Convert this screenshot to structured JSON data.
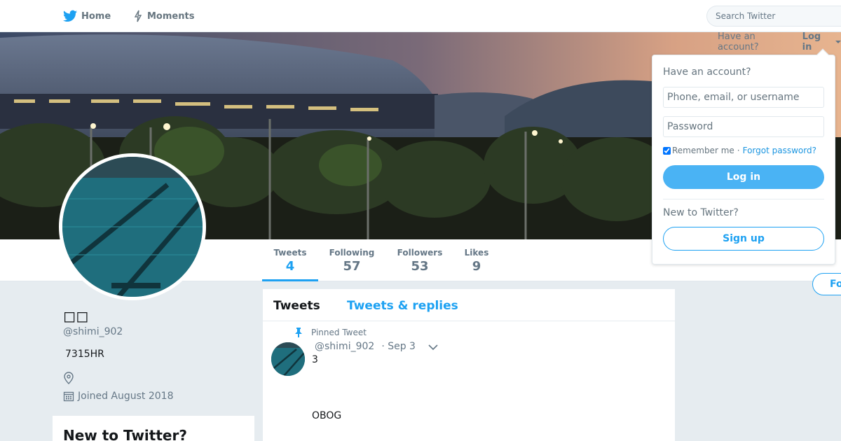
{
  "nav": {
    "home_label": "Home",
    "moments_label": "Moments",
    "search_placeholder": "Search Twitter"
  },
  "profile": {
    "name": "◻◻",
    "handle": "@shimi_902",
    "bio": "7315HR",
    "joined": "Joined August 2018"
  },
  "stats": [
    {
      "label": "Tweets",
      "value": "4"
    },
    {
      "label": "Following",
      "value": "57"
    },
    {
      "label": "Followers",
      "value": "53"
    },
    {
      "label": "Likes",
      "value": "9"
    }
  ],
  "follow_label": "Fo",
  "timeline": {
    "tab_tweets": "Tweets",
    "tab_replies": "Tweets & replies",
    "pinned_label": "Pinned Tweet",
    "tweet": {
      "handle": "@shimi_902",
      "date": "· Sep 3",
      "line1": "3",
      "line2": "OBOG"
    }
  },
  "signup_card": {
    "title": "New to Twitter?"
  },
  "login": {
    "have_account_text": "Have an account?",
    "login_link": "Log in",
    "box_title": "Have an account?",
    "user_placeholder": "Phone, email, or username",
    "pass_placeholder": "Password",
    "remember": "Remember me",
    "separator": "·",
    "forgot": "Forgot password?",
    "login_button": "Log in",
    "new_text": "New to Twitter?",
    "signup_button": "Sign up"
  },
  "colors": {
    "accent": "#1da1f2",
    "login_button": "#4ab3f4",
    "page_bg": "#e6ecf0"
  }
}
